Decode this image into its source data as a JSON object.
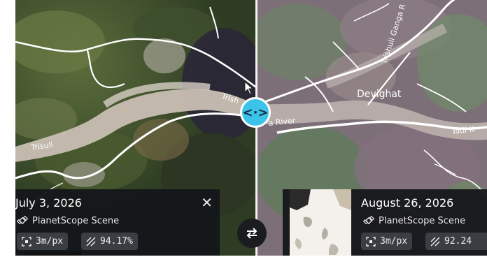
{
  "map": {
    "labels": {
      "trishuli_ganga_road": "Trishuli Ganga R",
      "devighat": "Devighat",
      "trishuli_mid": "Trish",
      "trishuli_left": "Trisuli",
      "ganga_river": "a River",
      "tadi": "Tadi K"
    }
  },
  "compare": {
    "handle_glyph": "<·>",
    "swap_glyph": "⇄"
  },
  "left_scene": {
    "date": "July 3, 2026",
    "close_glyph": "✕",
    "type": "PlanetScope Scene",
    "resolution": "3m/px",
    "coverage": "94.17%"
  },
  "right_scene": {
    "date": "August 26, 2026",
    "type": "PlanetScope Scene",
    "resolution": "3m/px",
    "coverage": "92.24"
  },
  "colors": {
    "accent": "#3cc3ea",
    "card_bg": "#141619",
    "chip_bg": "#3a3d42"
  }
}
